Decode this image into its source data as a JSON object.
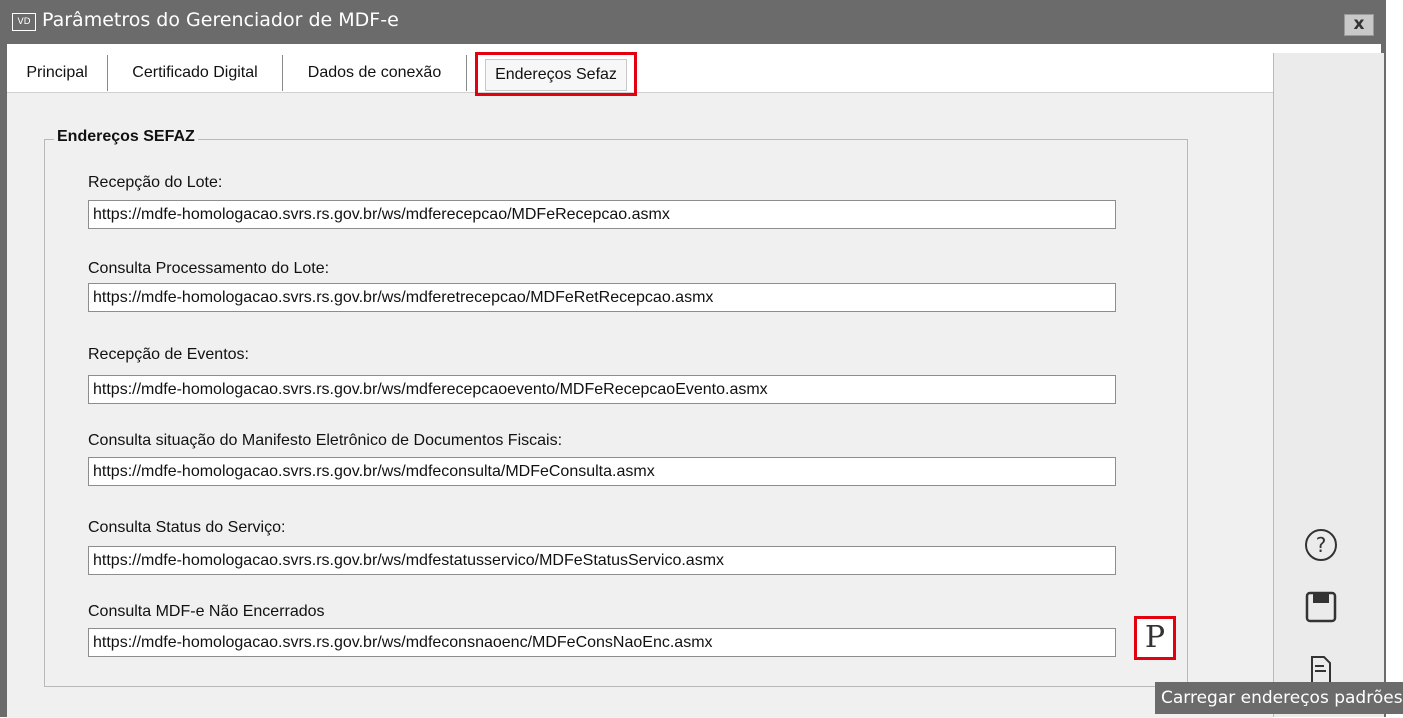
{
  "window": {
    "icon_text": "VD",
    "title": "Parâmetros do Gerenciador de MDF-e",
    "close_label": "x"
  },
  "tabs": [
    {
      "label": "Principal"
    },
    {
      "label": "Certificado Digital"
    },
    {
      "label": "Dados de conexão"
    },
    {
      "label": "Endereços Sefaz",
      "active": true
    }
  ],
  "group": {
    "title": "Endereços SEFAZ",
    "fields": [
      {
        "label": "Recepção do Lote:",
        "value": "https://mdfe-homologacao.svrs.rs.gov.br/ws/mdferecepcao/MDFeRecepcao.asmx"
      },
      {
        "label": "Consulta Processamento do Lote:",
        "value": "https://mdfe-homologacao.svrs.rs.gov.br/ws/mdferetrecepcao/MDFeRetRecepcao.asmx"
      },
      {
        "label": "Recepção de Eventos:",
        "value": "https://mdfe-homologacao.svrs.rs.gov.br/ws/mdferecepcaoevento/MDFeRecepcaoEvento.asmx"
      },
      {
        "label": "Consulta situação do Manifesto Eletrônico de Documentos Fiscais:",
        "value": "https://mdfe-homologacao.svrs.rs.gov.br/ws/mdfeconsulta/MDFeConsulta.asmx"
      },
      {
        "label": "Consulta Status do Serviço:",
        "value": "https://mdfe-homologacao.svrs.rs.gov.br/ws/mdfestatusservico/MDFeStatusServico.asmx"
      },
      {
        "label": "Consulta MDF-e Não Encerrados",
        "value": "https://mdfe-homologacao.svrs.rs.gov.br/ws/mdfeconsnaoenc/MDFeConsNaoEnc.asmx"
      }
    ]
  },
  "load_defaults_button": {
    "label": "P"
  },
  "tooltip": {
    "text": "Carregar endereços padrões"
  },
  "sidebar": {
    "icons": [
      "help-icon",
      "save-icon",
      "document-icon"
    ]
  },
  "colors": {
    "highlight": "#e3000f",
    "titlebar": "#6b6b6b",
    "panel": "#f0f0f0"
  }
}
